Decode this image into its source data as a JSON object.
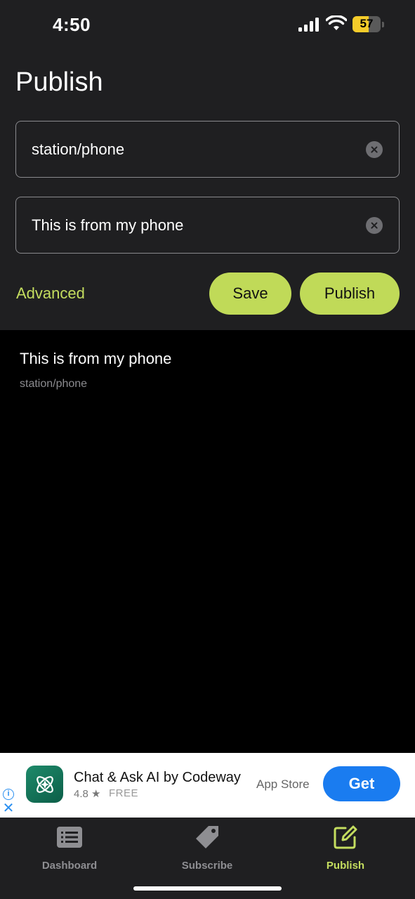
{
  "status_bar": {
    "time": "4:50",
    "battery": "57",
    "battery_level": 0.57,
    "icons": [
      "cellular-signal-icon",
      "wifi-icon",
      "battery-icon"
    ]
  },
  "page": {
    "title": "Publish"
  },
  "form": {
    "topic_value": "station/phone",
    "message_value": "This is from my phone",
    "advanced_label": "Advanced",
    "save_label": "Save",
    "publish_label": "Publish"
  },
  "messages": [
    {
      "text": "This is from my phone",
      "topic": "station/phone"
    }
  ],
  "ad": {
    "title": "Chat & Ask AI by Codeway",
    "rating": "4.8 ★",
    "price": "FREE",
    "store": "App Store",
    "cta": "Get"
  },
  "tabs": [
    {
      "label": "Dashboard",
      "icon": "list-icon",
      "active": false
    },
    {
      "label": "Subscribe",
      "icon": "tag-icon",
      "active": false
    },
    {
      "label": "Publish",
      "icon": "edit-square-icon",
      "active": true
    }
  ],
  "colors": {
    "accent": "#c0da58",
    "panel": "#1f1f21",
    "background": "#000000",
    "ad_button": "#1a7cf0"
  }
}
